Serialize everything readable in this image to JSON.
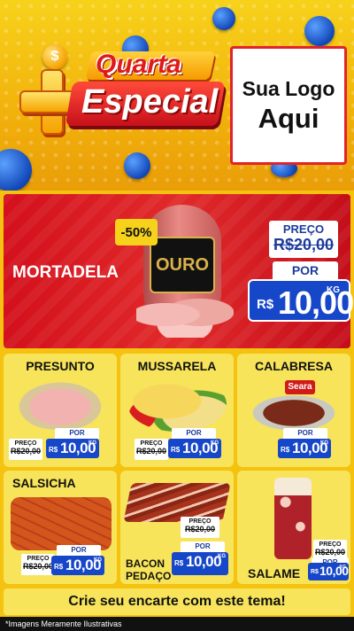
{
  "header": {
    "title_line1": "Quarta",
    "title_line2": "Especial",
    "logo_line1": "Sua Logo",
    "logo_line2": "Aqui",
    "coin_symbol": "$"
  },
  "hero": {
    "name": "MORTADELA",
    "discount": "-50%",
    "brand": "OURO",
    "preco_label": "PREÇO",
    "old_price": "R$20,00",
    "por_label": "POR",
    "currency": "R$",
    "price": "10,00",
    "unit": "KG"
  },
  "products": [
    {
      "name": "PRESUNTO",
      "preco_label": "PREÇO",
      "old_price": "R$20,00",
      "por_label": "POR",
      "currency": "R$",
      "price": "10,00",
      "unit": "KG"
    },
    {
      "name": "MUSSARELA",
      "preco_label": "PREÇO",
      "old_price": "R$20,00",
      "por_label": "POR",
      "currency": "R$",
      "price": "10,00",
      "unit": "KG"
    },
    {
      "name": "CALABRESA",
      "brand": "Seara",
      "preco_label": "PREÇO",
      "old_price": "R$20,00",
      "por_label": "POR",
      "currency": "R$",
      "price": "10,00",
      "unit": "KG"
    },
    {
      "name": "SALSICHA",
      "preco_label": "PREÇO",
      "old_price": "R$20,00",
      "por_label": "POR",
      "currency": "R$",
      "price": "10,00",
      "unit": "KG"
    },
    {
      "name_line1": "BACON",
      "name_line2": "PEDAÇO",
      "preco_label": "PREÇO",
      "old_price": "R$20,00",
      "por_label": "POR",
      "currency": "R$",
      "price": "10,00",
      "unit": "KG"
    },
    {
      "name": "SALAME",
      "preco_label": "PREÇO",
      "old_price": "R$20,00",
      "por_label": "POR",
      "currency": "R$",
      "price": "10,00",
      "unit": "KG"
    }
  ],
  "footer": {
    "cta": "Crie seu encarte com este tema!",
    "disclaimer": "*Imagens Meramente Ilustrativas"
  }
}
